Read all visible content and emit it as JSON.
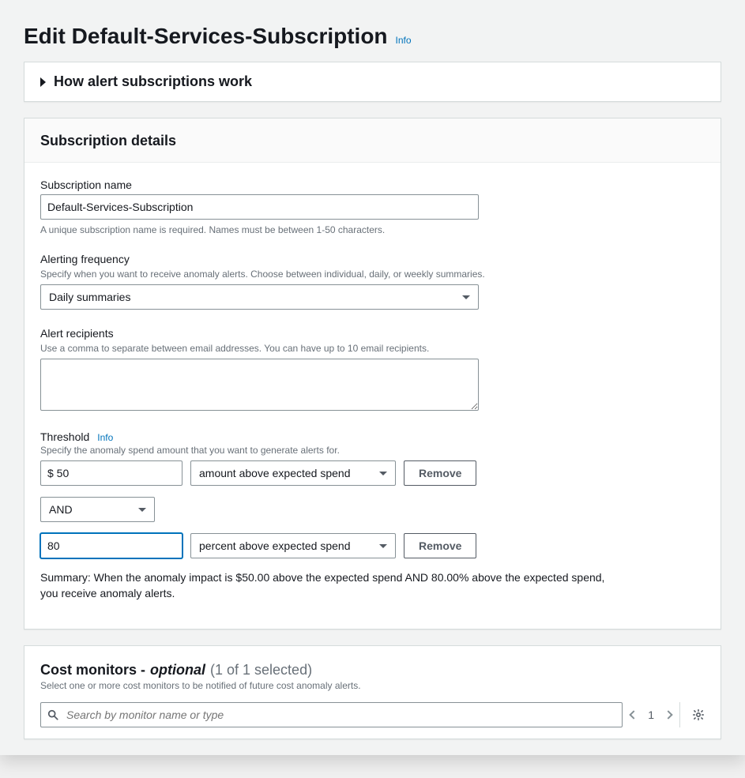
{
  "header": {
    "title": "Edit Default-Services-Subscription",
    "info_label": "Info"
  },
  "how_alerts": {
    "title": "How alert subscriptions work"
  },
  "subscription_panel": {
    "title": "Subscription details",
    "name": {
      "label": "Subscription name",
      "value": "Default-Services-Subscription",
      "help": "A unique subscription name is required. Names must be between 1-50 characters."
    },
    "frequency": {
      "label": "Alerting frequency",
      "help": "Specify when you want to receive anomaly alerts. Choose between individual, daily, or weekly summaries.",
      "value": "Daily summaries"
    },
    "recipients": {
      "label": "Alert recipients",
      "help": "Use a comma to separate between email addresses. You can have up to 10 email recipients.",
      "value": ""
    },
    "threshold": {
      "label": "Threshold",
      "info_label": "Info",
      "help": "Specify the anomaly spend amount that you want to generate alerts for.",
      "rows": [
        {
          "amount": "$ 50",
          "type": "amount above expected spend",
          "remove": "Remove"
        },
        {
          "amount": "80",
          "type": "percent above expected spend",
          "remove": "Remove"
        }
      ],
      "join_op": "AND",
      "summary": "Summary: When the anomaly impact is $50.00 above the expected spend AND 80.00% above the expected spend, you receive anomaly alerts."
    }
  },
  "cost_monitors": {
    "title": "Cost monitors -",
    "optional": "optional",
    "count": "(1 of 1 selected)",
    "help": "Select one or more cost monitors to be notified of future cost anomaly alerts.",
    "search_placeholder": "Search by monitor name or type",
    "page": "1"
  }
}
